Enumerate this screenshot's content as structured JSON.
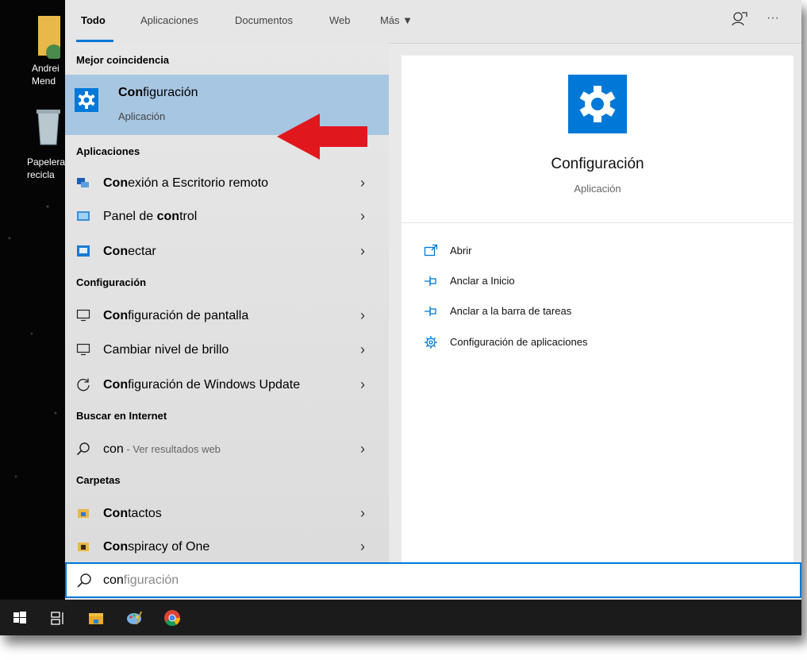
{
  "desktop": {
    "icon1_label1": "Andrei",
    "icon1_label2": "Mend",
    "icon2_label1": "Papelera",
    "icon2_label2": "recicla"
  },
  "tabs": [
    {
      "label": "Todo",
      "active": true
    },
    {
      "label": "Aplicaciones",
      "active": false
    },
    {
      "label": "Documentos",
      "active": false
    },
    {
      "label": "Web",
      "active": false
    },
    {
      "label": "Más ▼",
      "active": false
    }
  ],
  "tabs_extra": {
    "feedback_icon": "feedback-icon",
    "more_glyph": "···"
  },
  "best_match": {
    "section": "Mejor coincidencia",
    "name_bold": "Con",
    "name_rest": "figuración",
    "type": "Aplicación",
    "highlight_color": "#a7c6e2",
    "arrow_color": "#e1171e"
  },
  "sections": {
    "apps": "Aplicaciones",
    "settings": "Configuración",
    "web": "Buscar en Internet",
    "folders": "Carpetas"
  },
  "apps": [
    {
      "bold": "Con",
      "rest": "exión a Escritorio remoto",
      "icon": "remote-desktop-icon"
    },
    {
      "pre": "Panel de ",
      "bold": "con",
      "rest": "trol",
      "icon": "control-panel-icon"
    },
    {
      "bold": "Con",
      "rest": "ectar",
      "icon": "connect-icon"
    }
  ],
  "settings": [
    {
      "bold": "Con",
      "rest": "figuración de pantalla",
      "icon": "monitor-icon"
    },
    {
      "pre": "Cambiar nivel de brillo",
      "bold": "",
      "rest": "",
      "icon": "monitor-icon"
    },
    {
      "bold": "Con",
      "rest": "figuración de Windows Update",
      "icon": "refresh-icon"
    }
  ],
  "web": {
    "query": "con",
    "suffix": " - Ver resultados web",
    "icon": "search-icon"
  },
  "folders": [
    {
      "bold": "Con",
      "rest": "tactos",
      "icon": "folder-icon"
    },
    {
      "bold": "Con",
      "rest": "spiracy of One",
      "icon": "folder-icon"
    }
  ],
  "preview": {
    "title": "Configuración",
    "subtitle": "Aplicación",
    "accent": "#0078d7",
    "actions": [
      {
        "label": "Abrir",
        "icon": "open-icon"
      },
      {
        "label": "Anclar a Inicio",
        "icon": "pin-icon"
      },
      {
        "label": "Anclar a la barra de tareas",
        "icon": "pin-icon"
      },
      {
        "label": "Configuración de aplicaciones",
        "icon": "gear-icon"
      }
    ]
  },
  "search": {
    "typed": "con",
    "rest": "figuración"
  },
  "taskbar": [
    "windows-start-icon",
    "task-view-icon",
    "file-explorer-icon",
    "paint-icon",
    "chrome-icon"
  ]
}
